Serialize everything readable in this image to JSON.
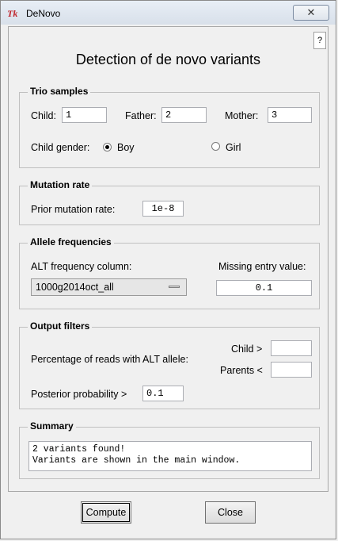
{
  "window": {
    "title": "DeNovo",
    "icon": "tk-feather-icon"
  },
  "help_label": "?",
  "main_title": "Detection of de novo variants",
  "trio": {
    "legend": "Trio samples",
    "child_label": "Child:",
    "child_value": "1",
    "father_label": "Father:",
    "father_value": "2",
    "mother_label": "Mother:",
    "mother_value": "3",
    "gender_label": "Child gender:",
    "boy_label": "Boy",
    "girl_label": "Girl",
    "selected_gender": "Boy"
  },
  "mutation": {
    "legend": "Mutation rate",
    "prior_label": "Prior mutation rate:",
    "prior_value": "1e-8"
  },
  "allele": {
    "legend": "Allele frequencies",
    "column_label": "ALT frequency column:",
    "column_value": "1000g2014oct_all",
    "missing_label": "Missing entry value:",
    "missing_value": "0.1"
  },
  "filters": {
    "legend": "Output filters",
    "pct_label": "Percentage of reads with ALT allele:",
    "child_gt_label": "Child >",
    "child_gt_value": "",
    "parents_lt_label": "Parents <",
    "parents_lt_value": "",
    "posterior_label": "Posterior probability >",
    "posterior_value": "0.1"
  },
  "summary": {
    "legend": "Summary",
    "line1": "2 variants found!",
    "line2": "Variants are shown in the main window."
  },
  "buttons": {
    "compute": "Compute",
    "close": "Close"
  }
}
